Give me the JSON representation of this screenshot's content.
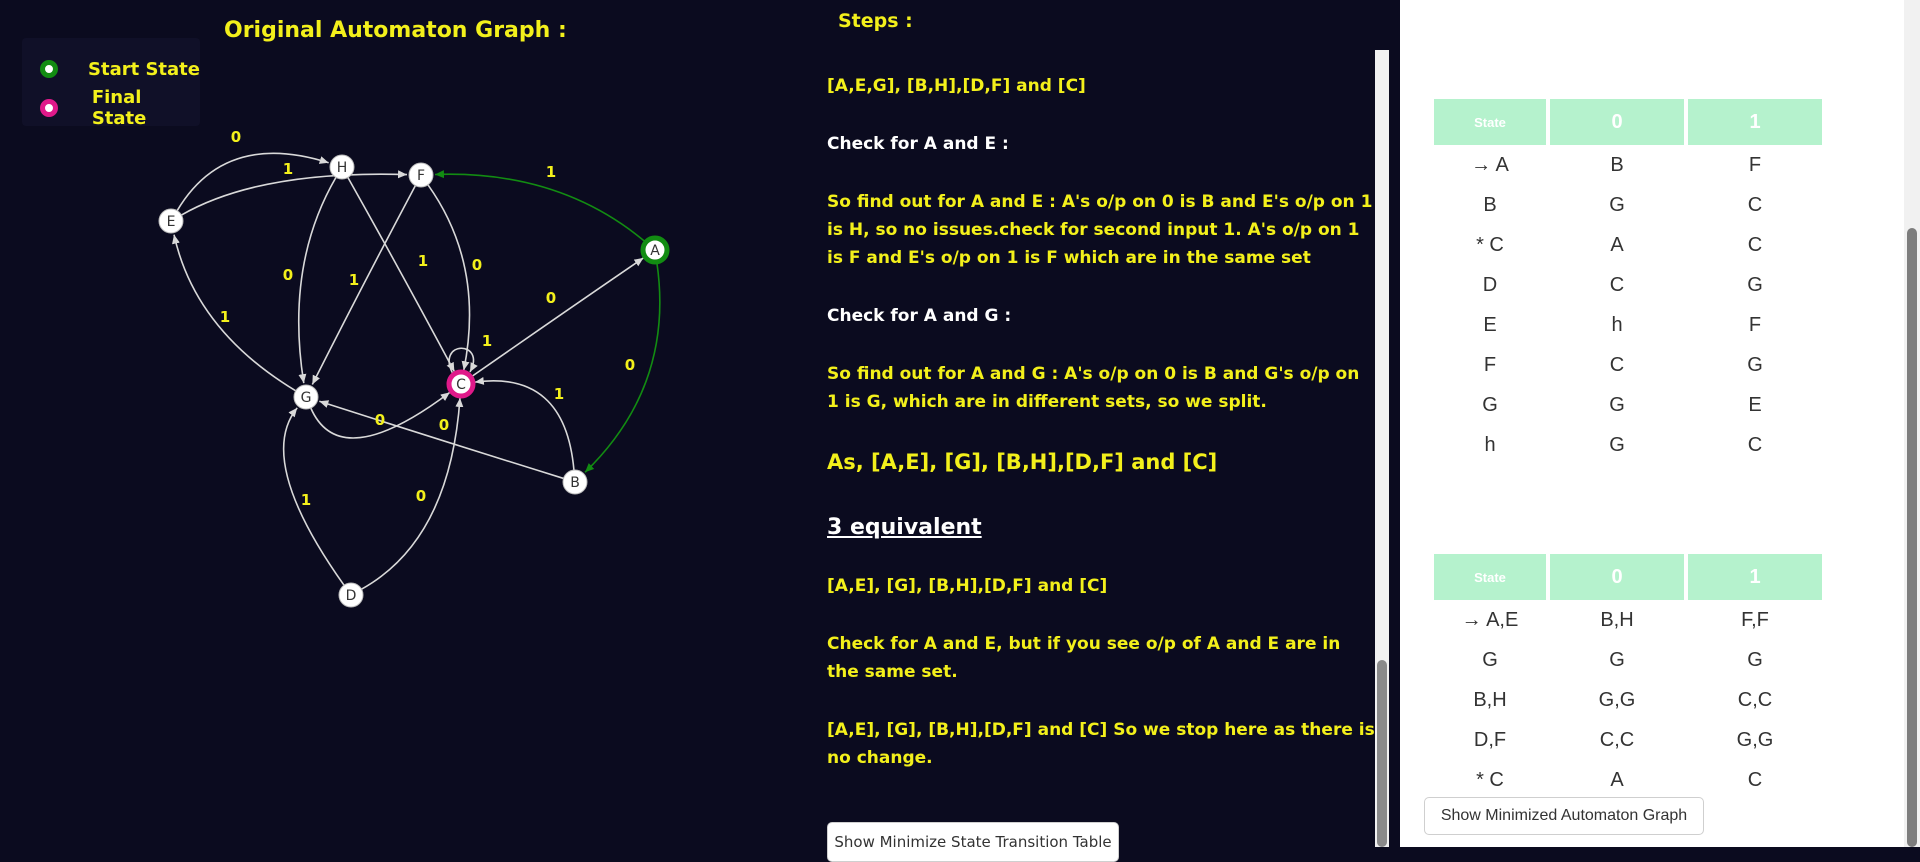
{
  "graph": {
    "title": "Original Automaton Graph :",
    "legend": {
      "start_label": "Start State",
      "final_label": "Final State"
    },
    "colors": {
      "start": "#128c12",
      "final": "#e0198a",
      "edge": "#d9d9d9",
      "start_edge": "#128c12",
      "label": "#f3f01b"
    },
    "nodes": [
      "A",
      "B",
      "C",
      "D",
      "E",
      "F",
      "G",
      "H"
    ],
    "start_state": "A",
    "final_states": [
      "C"
    ],
    "edges": [
      {
        "from": "E",
        "to": "H",
        "label": "0"
      },
      {
        "from": "E",
        "to": "F",
        "label": "1"
      },
      {
        "from": "A",
        "to": "F",
        "label": "1"
      },
      {
        "from": "A",
        "to": "B",
        "label": "0"
      },
      {
        "from": "H",
        "to": "G",
        "label": "0"
      },
      {
        "from": "H",
        "to": "C",
        "label": "1"
      },
      {
        "from": "F",
        "to": "G",
        "label": "1"
      },
      {
        "from": "F",
        "to": "C",
        "label": "0"
      },
      {
        "from": "G",
        "to": "E",
        "label": "1"
      },
      {
        "from": "G",
        "to": "C",
        "label": "0"
      },
      {
        "from": "C",
        "to": "A",
        "label": "0"
      },
      {
        "from": "C",
        "to": "C",
        "label": "1"
      },
      {
        "from": "B",
        "to": "G",
        "label": "0"
      },
      {
        "from": "B",
        "to": "C",
        "label": "1"
      },
      {
        "from": "D",
        "to": "G",
        "label": "1"
      },
      {
        "from": "D",
        "to": "C",
        "label": "0"
      }
    ]
  },
  "steps": {
    "title": "Steps :",
    "p1": "[A,E,G], [B,H],[D,F] and [C]",
    "p2": "Check for A and E :",
    "p3": "So find out for A and E : A's o/p on 0 is B and E's o/p on 1 is H, so no issues.check for second input 1. A's o/p on 1 is F and E's o/p on 1 is F which are in the same set",
    "p4": "Check for A and G :",
    "p5": "So find out for A and G : A's o/p on 0 is B and G's o/p on 1 is G, which are in different sets, so we split.",
    "p6": "As, [A,E], [G], [B,H],[D,F] and [C]",
    "p7": "3 equivalent",
    "p8": "[A,E], [G], [B,H],[D,F] and [C]",
    "p9": "Check for A and E, but if you see o/p of A and E are in the same set.",
    "p10": "[A,E], [G], [B,H],[D,F] and [C] So we stop here as there is no change.",
    "minimize_button": "Show Minimize State Transition Table"
  },
  "table1": {
    "headers": [
      "State",
      "0",
      "1"
    ],
    "rows": [
      [
        "→ A",
        "B",
        "F"
      ],
      [
        "B",
        "G",
        "C"
      ],
      [
        "* C",
        "A",
        "C"
      ],
      [
        "D",
        "C",
        "G"
      ],
      [
        "E",
        "h",
        "F"
      ],
      [
        "F",
        "C",
        "G"
      ],
      [
        "G",
        "G",
        "E"
      ],
      [
        "h",
        "G",
        "C"
      ]
    ]
  },
  "table2": {
    "headers": [
      "State",
      "0",
      "1"
    ],
    "rows": [
      [
        "→ A,E",
        "B,H",
        "F,F"
      ],
      [
        "G",
        "G",
        "G"
      ],
      [
        "B,H",
        "G,G",
        "C,C"
      ],
      [
        "D,F",
        "C,C",
        "G,G"
      ],
      [
        "* C",
        "A",
        "C"
      ]
    ]
  },
  "min_graph_button": "Show Minimized Automaton Graph"
}
